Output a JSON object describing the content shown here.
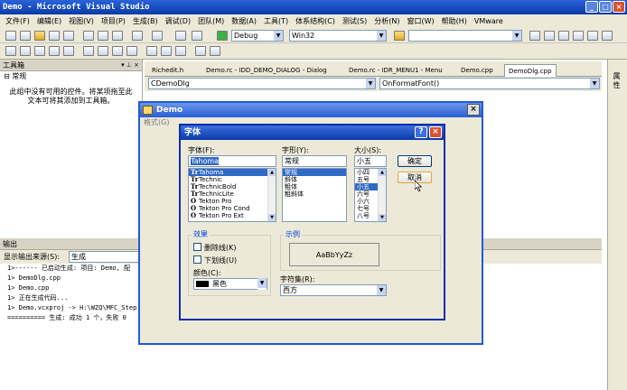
{
  "window": {
    "title": "Demo - Microsoft Visual Studio"
  },
  "menu": [
    "文件(F)",
    "编辑(E)",
    "视图(V)",
    "项目(P)",
    "生成(B)",
    "调试(D)",
    "团队(M)",
    "数据(A)",
    "工具(T)",
    "体系结构(C)",
    "测试(S)",
    "分析(N)",
    "窗口(W)",
    "帮助(H)",
    "VMware"
  ],
  "toolbar": {
    "config": "Debug",
    "platform": "Win32"
  },
  "toolbox": {
    "title": "工具箱",
    "group": "常规",
    "empty_text_line1": "此组中没有可用的控件。将某项拖至此",
    "empty_text_line2": "文本可将其添加到工具箱。"
  },
  "tabs": [
    "Richedit.h",
    "Demo.rc - IDD_DEMO_DIALOG - Dialog",
    "Demo.rc - IDR_MENU1 - Menu",
    "Demo.cpp",
    "DemoDlg.cpp"
  ],
  "nav": {
    "class_combo": "CDemoDlg",
    "method_combo": "OnFormatFont()"
  },
  "right_strip_label": "属性",
  "output": {
    "title": "输出",
    "source_label": "显示输出来源(S):",
    "source_value": "生成",
    "lines": [
      "1>------ 已启动生成: 项目: Demo, 配",
      "1>  DemoDlg.cpp",
      "1>  Demo.cpp",
      "1>  正在生成代码...",
      "1>  Demo.vcxproj -> H:\\WZQ\\MFC_Step",
      "========== 生成: 成功 1 个，失败 0"
    ]
  },
  "demo_dialog": {
    "title": "Demo",
    "menu_item": "格式(G)"
  },
  "font_dialog": {
    "title": "字体",
    "font_label": "字体(F):",
    "font_value": "Tahoma",
    "fonts": [
      "Tahoma",
      "Technic",
      "TechnicBold",
      "TechnicLite",
      "Tekton Pro",
      "Tekton Pro Cond",
      "Tekton Pro Ext"
    ],
    "style_label": "字形(Y):",
    "style_value": "常规",
    "styles": [
      "常规",
      "斜体",
      "粗体",
      "粗斜体"
    ],
    "size_label": "大小(S):",
    "size_value": "小五",
    "sizes": [
      "小四",
      "五号",
      "小五",
      "六号",
      "小六",
      "七号",
      "八号"
    ],
    "ok": "确定",
    "cancel": "取消",
    "effects_title": "效果",
    "strikeout": "删除线(K)",
    "underline": "下划线(U)",
    "color_label": "颜色(C):",
    "color_value": "黑色",
    "sample_title": "示例",
    "sample_text": "AaBbYyZz",
    "charset_label": "字符集(R):",
    "charset_value": "西方"
  }
}
